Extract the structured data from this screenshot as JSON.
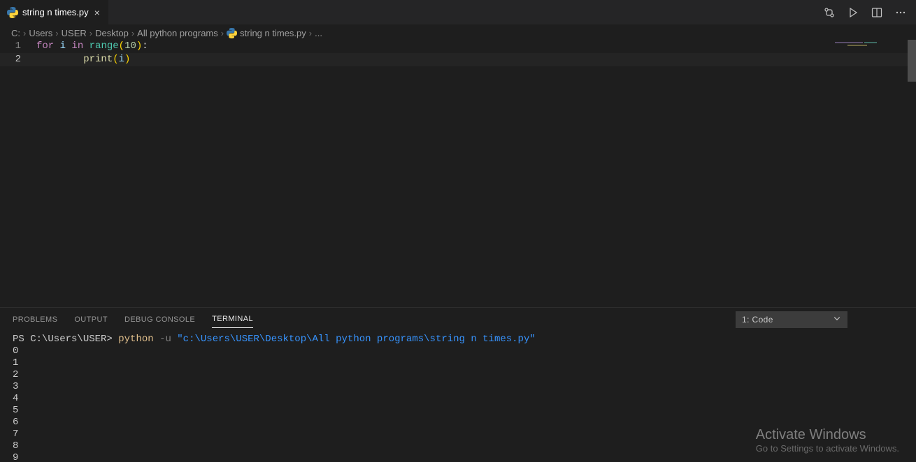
{
  "tab": {
    "filename": "string n times.py"
  },
  "breadcrumb": {
    "parts": [
      "C:",
      "Users",
      "USER",
      "Desktop",
      "All python programs"
    ],
    "file": "string n times.py",
    "tail": "..."
  },
  "code": {
    "lines": [
      {
        "n": "1",
        "tokens": [
          {
            "t": "for ",
            "c": "tok-kw"
          },
          {
            "t": "i ",
            "c": "tok-var"
          },
          {
            "t": "in ",
            "c": "tok-kw"
          },
          {
            "t": "range",
            "c": "tok-call"
          },
          {
            "t": "(",
            "c": "tok-punc"
          },
          {
            "t": "10",
            "c": "tok-num"
          },
          {
            "t": ")",
            "c": "tok-punc"
          },
          {
            "t": ":",
            "c": "tok-p"
          }
        ]
      },
      {
        "n": "2",
        "tokens": [
          {
            "t": "        ",
            "c": ""
          },
          {
            "t": "print",
            "c": "tok-fn"
          },
          {
            "t": "(",
            "c": "tok-punc"
          },
          {
            "t": "i",
            "c": "tok-var"
          },
          {
            "t": ")",
            "c": "tok-punc"
          }
        ],
        "current": true
      }
    ]
  },
  "panel": {
    "tabs": [
      "PROBLEMS",
      "OUTPUT",
      "DEBUG CONSOLE",
      "TERMINAL"
    ],
    "active": "TERMINAL",
    "selector": "1: Code"
  },
  "terminal": {
    "prompt": "PS C:\\Users\\USER>",
    "cmd": "python",
    "flag": "-u",
    "arg": "\"c:\\Users\\USER\\Desktop\\All python programs\\string n times.py\"",
    "output": [
      "0",
      "1",
      "2",
      "3",
      "4",
      "5",
      "6",
      "7",
      "8",
      "9"
    ]
  },
  "watermark": {
    "title": "Activate Windows",
    "subtitle": "Go to Settings to activate Windows."
  }
}
